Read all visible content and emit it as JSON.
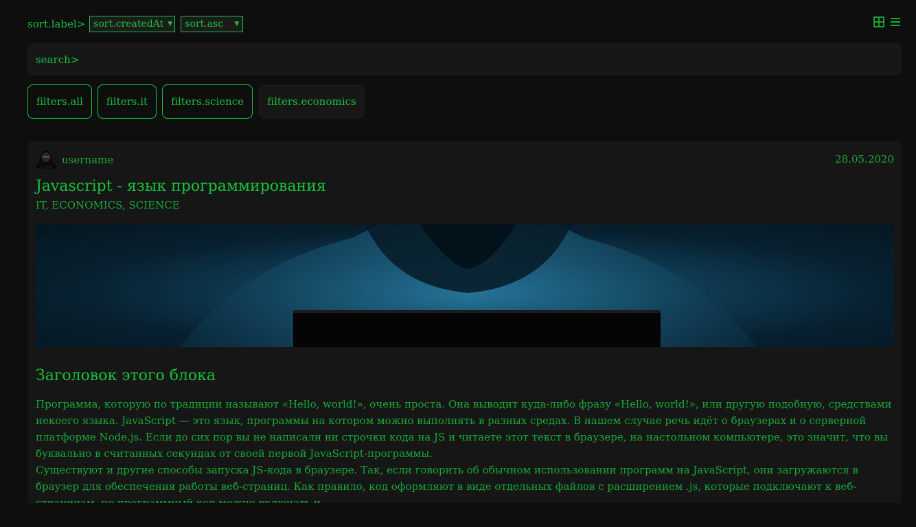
{
  "sort": {
    "label": "sort.label>",
    "field_value": "sort.createdAt",
    "order_value": "sort.asc"
  },
  "view": {
    "grid_icon": "grid-icon",
    "list_icon": "list-icon"
  },
  "search": {
    "label": "search>"
  },
  "filters": [
    "filters.all",
    "filters.it",
    "filters.science",
    "filters.economics"
  ],
  "post": {
    "username": "username",
    "date": "28.05.2020",
    "title": "Javascript - язык программирования",
    "tags": "IT, ECONOMICS, SCIENCE",
    "block_title": "Заголовок этого блока",
    "paragraphs": [
      "Программа, которую по традиции называют «Hello, world!», очень проста. Она выводит куда-либо фразу «Hello, world!», или другую подобную, средствами некоего языка. JavaScript — это язык, программы на котором можно выполнять в разных средах. В нашем случае речь идёт о браузерах и о серверной платформе Node.js. Если до сих пор вы не написали ни строчки кода на JS и читаете этот текст в браузере, на настольном компьютере, это значит, что вы буквально в считанных секундах от своей первой JavaScript-программы.",
      "Существуют и другие способы запуска JS-кода в браузере. Так, если говорить об обычном использовании программ на JavaScript, они загружаются в браузер для обеспечения работы веб-страниц. Как правило, код оформляют в виде отдельных файлов с расширением .js, которые подключают к веб-страницам, но программный код можно включать и"
    ]
  },
  "colors": {
    "accent": "#18c23a",
    "background": "#0e0e0e",
    "card": "#161616"
  }
}
